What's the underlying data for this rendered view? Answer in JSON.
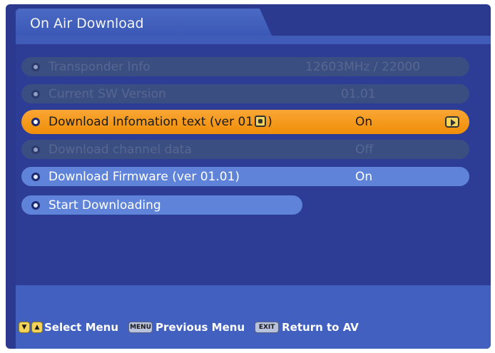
{
  "header": {
    "title": "On Air Download"
  },
  "menu": {
    "items": [
      {
        "label": "Transponder Info",
        "value": "12603MHz / 22000",
        "state": "disabled"
      },
      {
        "label": "Current SW Version",
        "value": "01.01",
        "state": "disabled"
      },
      {
        "label_prefix": "Download Infomation text (ver 01",
        "label_suffix": ")",
        "value": "On",
        "state": "focused"
      },
      {
        "label": "Download channel data",
        "value": "Off",
        "state": "disabled"
      },
      {
        "label": "Download Firmware (ver 01.01)",
        "value": "On",
        "state": "normal"
      },
      {
        "label": "Start Downloading",
        "state": "normal"
      }
    ]
  },
  "footer": {
    "select_label": "Select Menu",
    "menu_key": "MENU",
    "previous_label": "Previous Menu",
    "exit_key": "EXIT",
    "return_label": "Return to AV"
  },
  "colors": {
    "background": "#2b3a8e",
    "focus": "#f59a1e",
    "item": "#5e83d8",
    "disabled": "#3b4e82"
  }
}
